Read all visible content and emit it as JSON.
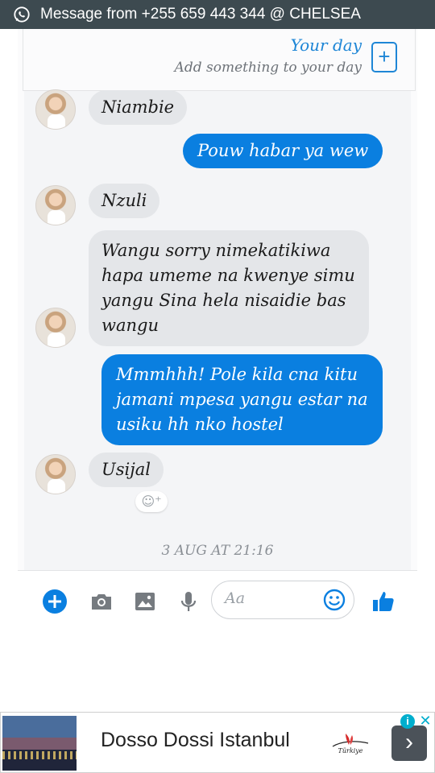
{
  "notification": {
    "icon": "whatsapp-icon",
    "text": "Message from +255 659 443 344 @ CHELSEA"
  },
  "story": {
    "title": "Your day",
    "subtitle": "Add something to your day",
    "add_icon": "plus-icon"
  },
  "messages": [
    {
      "from": "them",
      "text": "Niambie"
    },
    {
      "from": "me",
      "text": "Pouw habar ya wew"
    },
    {
      "from": "them",
      "text": "Nzuli"
    },
    {
      "from": "them",
      "text": "Wangu sorry nimekatikiwa hapa umeme na kwenye simu yangu Sina hela nisaidie bas wangu"
    },
    {
      "from": "me",
      "text": "Mmmhhh! Pole kila cna kitu jamani mpesa yangu estar na usiku hh nko hostel"
    },
    {
      "from": "them",
      "text": "Usijal"
    }
  ],
  "reaction_placeholder": "☺⁺",
  "timestamp": "3 AUG AT 21:16",
  "composer": {
    "placeholder": "Aa",
    "icons": [
      "add-icon",
      "camera-icon",
      "image-icon",
      "microphone-icon",
      "emoji-icon",
      "thumbs-up-icon"
    ]
  },
  "ad": {
    "title": "Dosso Dossi Istanbul",
    "logo_text": "Türkiye",
    "info": "i",
    "close": "✕",
    "arrow": "›"
  },
  "colors": {
    "accent": "#0a7fe0",
    "incoming_bubble": "#e4e6e9",
    "notification_bar": "#3d4a50"
  }
}
